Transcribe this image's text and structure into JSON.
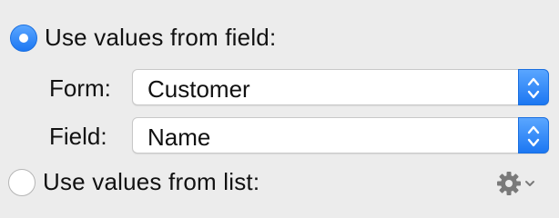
{
  "options": {
    "field_radio_label": "Use values from field:",
    "field_radio_selected": true,
    "list_radio_label": "Use values from list:",
    "list_radio_selected": false
  },
  "form": {
    "label": "Form:",
    "value": "Customer"
  },
  "field": {
    "label": "Field:",
    "value": "Name"
  },
  "icons": {
    "stepper": "up-down-chevron-icon",
    "action_menu": "gear-icon",
    "action_menu_arrow": "chevron-down-icon"
  },
  "colors": {
    "accent": "#1c77f2",
    "background": "#ececec"
  }
}
